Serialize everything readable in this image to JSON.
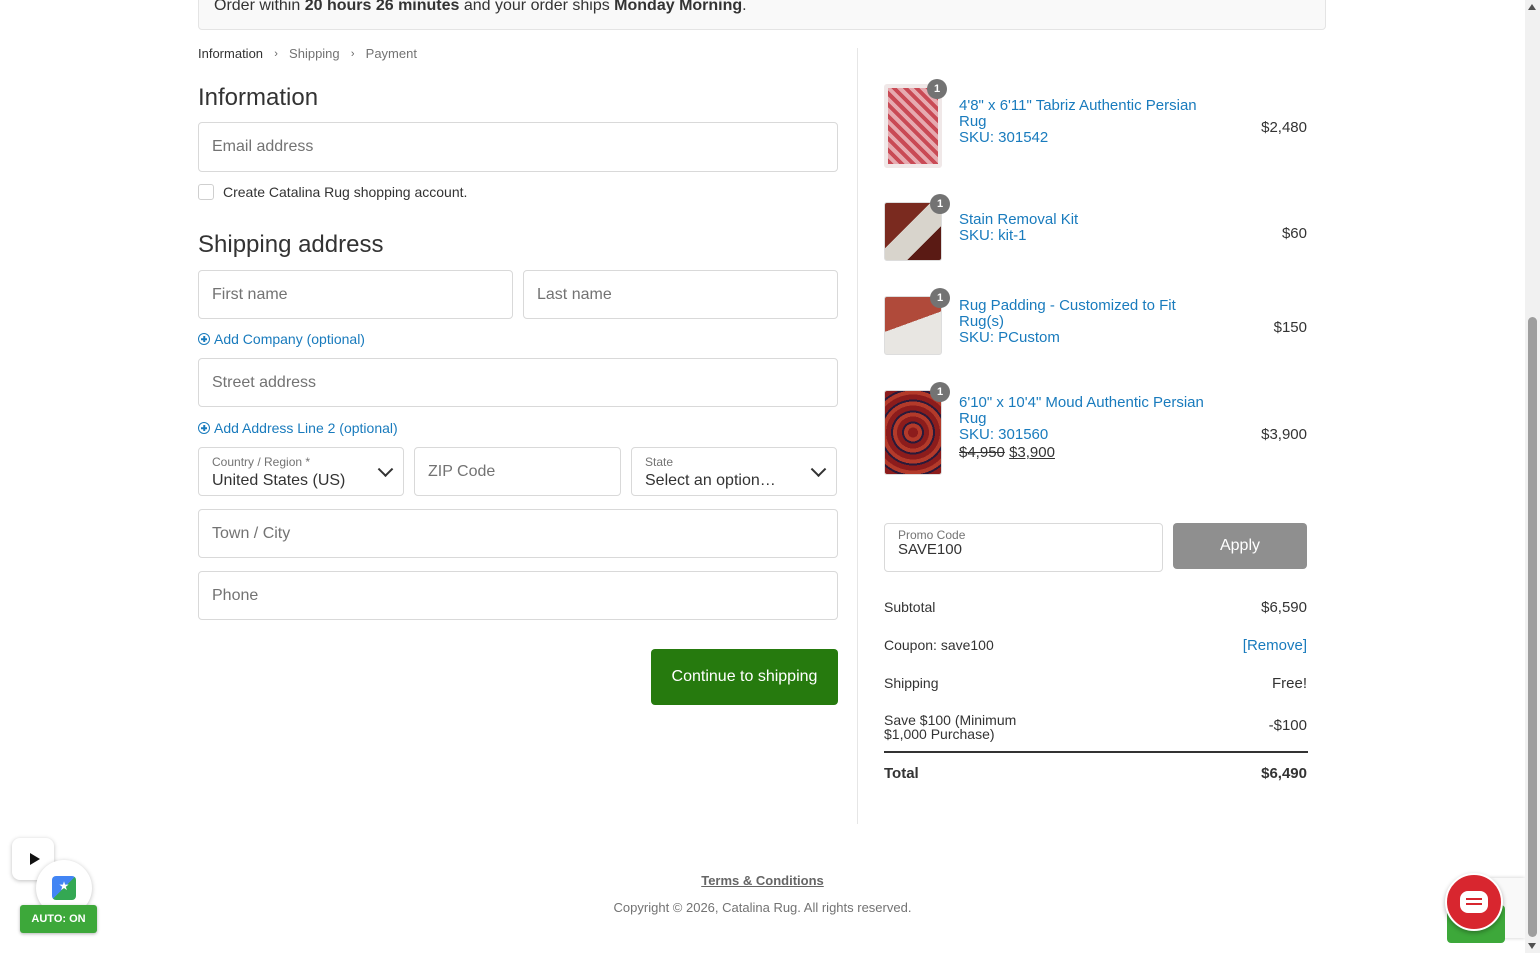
{
  "notice": {
    "prefix": "Order within ",
    "time": "20 hours 26 minutes",
    "middle": " and your order ships ",
    "ship_day": "Monday Morning",
    "suffix": "."
  },
  "breadcrumb": {
    "information": "Information",
    "shipping": "Shipping",
    "payment": "Payment"
  },
  "information": {
    "heading": "Information",
    "email_placeholder": "Email address",
    "create_account_label": "Create Catalina Rug shopping account."
  },
  "shipping_address": {
    "heading": "Shipping address",
    "first_name_placeholder": "First name",
    "last_name_placeholder": "Last name",
    "add_company": "Add Company (optional)",
    "street_placeholder": "Street address",
    "add_address_line2": "Add Address Line 2 (optional)",
    "country_label": "Country / Region *",
    "country_value": "United States (US)",
    "zip_placeholder": "ZIP Code",
    "state_label": "State",
    "state_value": "Select an option…",
    "city_placeholder": "Town / City",
    "phone_placeholder": "Phone",
    "continue_button": "Continue to shipping"
  },
  "cart_items": [
    {
      "qty": "1",
      "name_line1": "4'8\" x 6'11\" Tabriz Authentic Persian",
      "name_line2": "Rug",
      "sku": "SKU: 301542",
      "price": "$2,480"
    },
    {
      "qty": "1",
      "name_line1": "Stain Removal Kit",
      "name_line2": "",
      "sku": "SKU: kit-1",
      "price": "$60"
    },
    {
      "qty": "1",
      "name_line1": "Rug Padding - Customized to Fit",
      "name_line2": "Rug(s)",
      "sku": "SKU: PCustom",
      "price": "$150"
    },
    {
      "qty": "1",
      "name_line1": "6'10\" x 10'4\" Moud Authentic Persian",
      "name_line2": "Rug",
      "sku": "SKU: 301560",
      "old_price": "$4,950",
      "sale_price": "$3,900",
      "price": "$3,900"
    }
  ],
  "promo": {
    "label": "Promo Code",
    "value": "SAVE100",
    "apply_button": "Apply"
  },
  "summary": {
    "subtotal_label": "Subtotal",
    "subtotal_value": "$6,590",
    "coupon_label": "Coupon: save100",
    "coupon_remove": "[Remove]",
    "shipping_label": "Shipping",
    "shipping_value": "Free!",
    "discount_label_line1": "Save $100 (Minimum",
    "discount_label_line2": "$1,000 Purchase)",
    "discount_value": "-$100",
    "total_label": "Total",
    "total_value": "$6,490"
  },
  "footer": {
    "terms": "Terms & Conditions",
    "copyright": "Copyright © 2026, Catalina Rug. All rights reserved."
  },
  "widgets": {
    "auto_badge": "AUTO: ON"
  },
  "colors": {
    "link": "#197bbd",
    "primary_button": "#267a0e",
    "apply_button": "#8f8f8f"
  }
}
